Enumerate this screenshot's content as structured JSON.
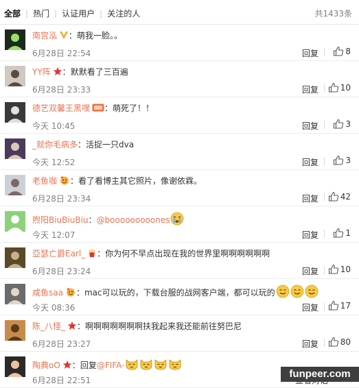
{
  "filters": {
    "tabs": [
      {
        "label": "全部",
        "active": true
      },
      {
        "label": "热门",
        "active": false
      },
      {
        "label": "认证用户",
        "active": false
      },
      {
        "label": "关注的人",
        "active": false
      }
    ],
    "total_count": "共1433条"
  },
  "comments": [
    {
      "username": "南宫泓",
      "badge": "v-badge",
      "text": "萌我一脸。。",
      "time": "6月28日 22:54",
      "reply": "回复",
      "likes": "8"
    },
    {
      "username": "YY阵",
      "badge": "star-badge",
      "text": "默默看了三百遍",
      "time": "6月28日 23:33",
      "reply": "回复",
      "likes": "10"
    },
    {
      "username": "德艺双馨王黑嘿",
      "badge": "level-badge",
      "text": "萌死了！！",
      "time": "今天 10:45",
      "reply": "回复",
      "likes": "3"
    },
    {
      "username": "_就你毛病多",
      "badge": "",
      "text": "活捉一只dva",
      "time": "今天 12:52",
      "reply": "回复",
      "likes": "3"
    },
    {
      "username": "老鱼咖",
      "badge": "face-badge",
      "text": "看了看博主其它照片，像谢依霖。",
      "time": "6月28日 23:34",
      "reply": "回复",
      "likes": "42"
    },
    {
      "username": "煦阳BiuBiuBiu",
      "badge": "",
      "text": "",
      "mention": "@booooooooones",
      "emoji_count": 1,
      "emoji": "crying-face-emoji",
      "time": "今天 12:07",
      "reply": "回复",
      "likes": "1"
    },
    {
      "username": "亞瑟亡爵Earl_",
      "badge": "popcorn-badge",
      "text": "你为何不早点出现在我的世界里啊啊啊啊啊啊",
      "time": "6月28日 23:24",
      "reply": "回复",
      "likes": "10"
    },
    {
      "username": "咸鱼saa",
      "badge": "face-badge",
      "text": "mac可以玩的，下载台服的战网客户端，都可以玩的",
      "emoji_count": 3,
      "emoji": "smile-face-emoji",
      "time": "今天 08:36",
      "reply": "回复",
      "likes": "17"
    },
    {
      "username": "陈_八怪_",
      "badge": "star-badge",
      "text": "啊啊啊啊啊啊啊扶我起来我还能前往努巴尼",
      "time": "6月28日 23:27",
      "reply": "回复",
      "likes": "80"
    },
    {
      "username": "陶典oO",
      "badge": "star-badge",
      "text": "回复",
      "mention": "@FIFA-",
      "emoji_count": 4,
      "emoji": "cat-face-emoji",
      "time": "6月28日 22:51",
      "reply": "查看对话",
      "likes": ""
    }
  ],
  "watermark": "funpeer.com",
  "colors": {
    "username": "#eb7350",
    "time": "#808080",
    "accent_red": "#e5322d",
    "emoji_yellow": "#f7c948"
  }
}
